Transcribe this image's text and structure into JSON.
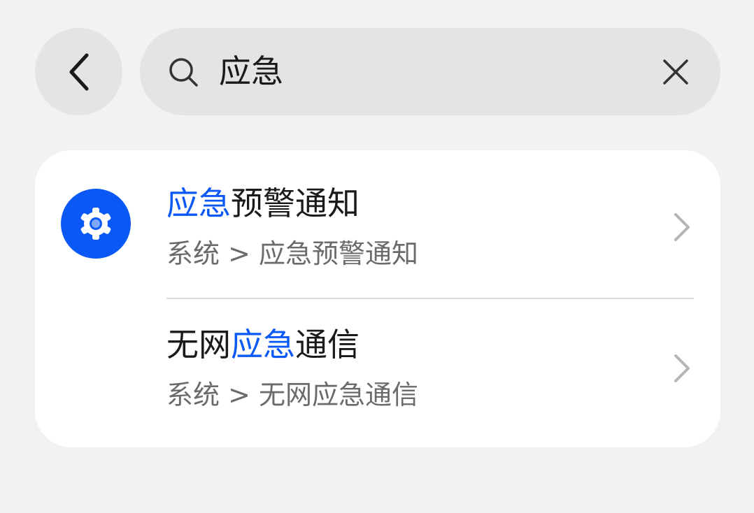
{
  "header": {
    "search": {
      "query": "应急"
    }
  },
  "results": [
    {
      "title_highlight": "应急",
      "title_rest": "预警通知",
      "path": "系统 > 应急预警通知",
      "icon": "settings-gear-icon"
    },
    {
      "title_prefix": "无网",
      "title_highlight": "应急",
      "title_rest": "通信",
      "path": "系统 > 无网应急通信"
    }
  ],
  "colors": {
    "background": "#f1f2f4",
    "surface": "#ffffff",
    "accent": "#0a59f7",
    "text_primary": "#1a1a1a",
    "text_secondary": "#6b6b6b"
  }
}
